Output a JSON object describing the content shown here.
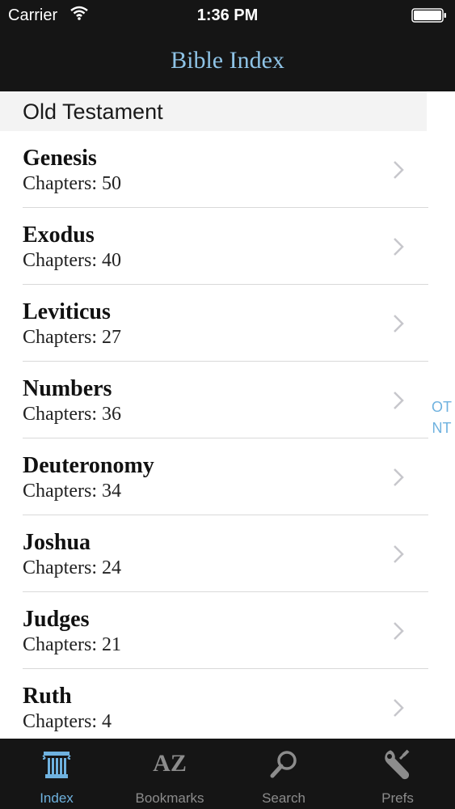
{
  "status_bar": {
    "carrier": "Carrier",
    "time": "1:36 PM",
    "wifi_icon": "wifi-icon",
    "battery_icon": "battery-icon"
  },
  "nav": {
    "title": "Bible Index"
  },
  "section": {
    "title": "Old Testament"
  },
  "books": [
    {
      "name": "Genesis",
      "chapters": "Chapters:  50"
    },
    {
      "name": "Exodus",
      "chapters": "Chapters:  40"
    },
    {
      "name": "Leviticus",
      "chapters": "Chapters:  27"
    },
    {
      "name": "Numbers",
      "chapters": "Chapters:  36"
    },
    {
      "name": "Deuteronomy",
      "chapters": "Chapters:  34"
    },
    {
      "name": "Joshua",
      "chapters": "Chapters:  24"
    },
    {
      "name": "Judges",
      "chapters": "Chapters:  21"
    },
    {
      "name": "Ruth",
      "chapters": "Chapters:  4"
    }
  ],
  "section_index": [
    "OT",
    "NT"
  ],
  "tabs": [
    {
      "label": "Index",
      "icon": "pillar-icon",
      "active": true
    },
    {
      "label": "Bookmarks",
      "icon": "AZ",
      "active": false
    },
    {
      "label": "Search",
      "icon": "magnifier-icon",
      "active": false
    },
    {
      "label": "Prefs",
      "icon": "wrench-icon",
      "active": false
    }
  ],
  "colors": {
    "bar_background": "#151515",
    "accent": "#6fb2df",
    "title": "#8ec3e6",
    "section_header_bg": "#f3f3f3"
  }
}
